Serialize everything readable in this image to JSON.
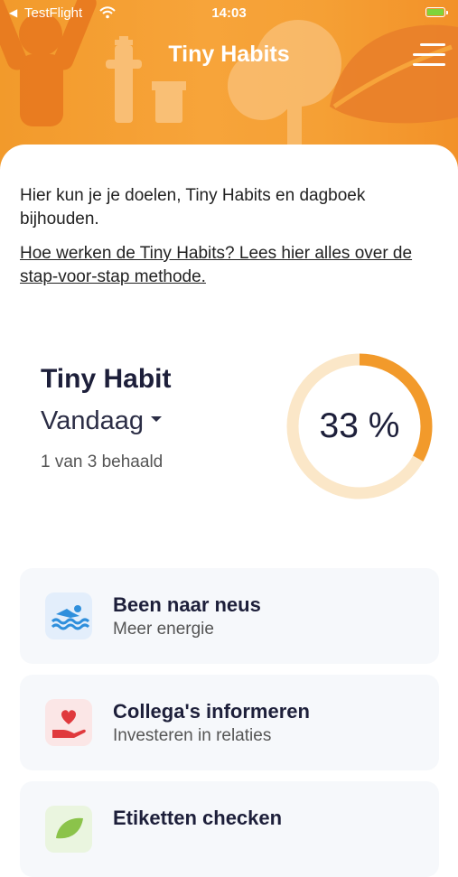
{
  "status_bar": {
    "back_label": "◀",
    "carrier": "TestFlight",
    "time": "14:03"
  },
  "header": {
    "title": "Tiny Habits"
  },
  "intro": {
    "text": "Hier kun je je doelen, Tiny Habits en dagboek bijhouden.",
    "link": "Hoe werken de Tiny Habits? Lees hier alles over de stap-voor-stap methode."
  },
  "summary": {
    "title": "Tiny Habit",
    "period": "Vandaag",
    "progress_text": "1 van 3 behaald",
    "percent_label": "33 %",
    "percent": 33
  },
  "habits": [
    {
      "name": "Been naar neus",
      "category": "Meer energie",
      "icon": "swimmer-icon",
      "icon_bg": "#e3eefb",
      "icon_color": "#2f8fdc"
    },
    {
      "name": "Collega's informeren",
      "category": "Investeren in relaties",
      "icon": "heart-hand-icon",
      "icon_bg": "#fbe6e6",
      "icon_color": "#e0393d"
    },
    {
      "name": "Etiketten checken",
      "category": "",
      "icon": "leaf-icon",
      "icon_bg": "#eaf5df",
      "icon_color": "#8bc34a"
    }
  ],
  "colors": {
    "brand_orange": "#f7a43a",
    "ring_track": "#fbe7c8",
    "ring_fill": "#f29a2b"
  }
}
